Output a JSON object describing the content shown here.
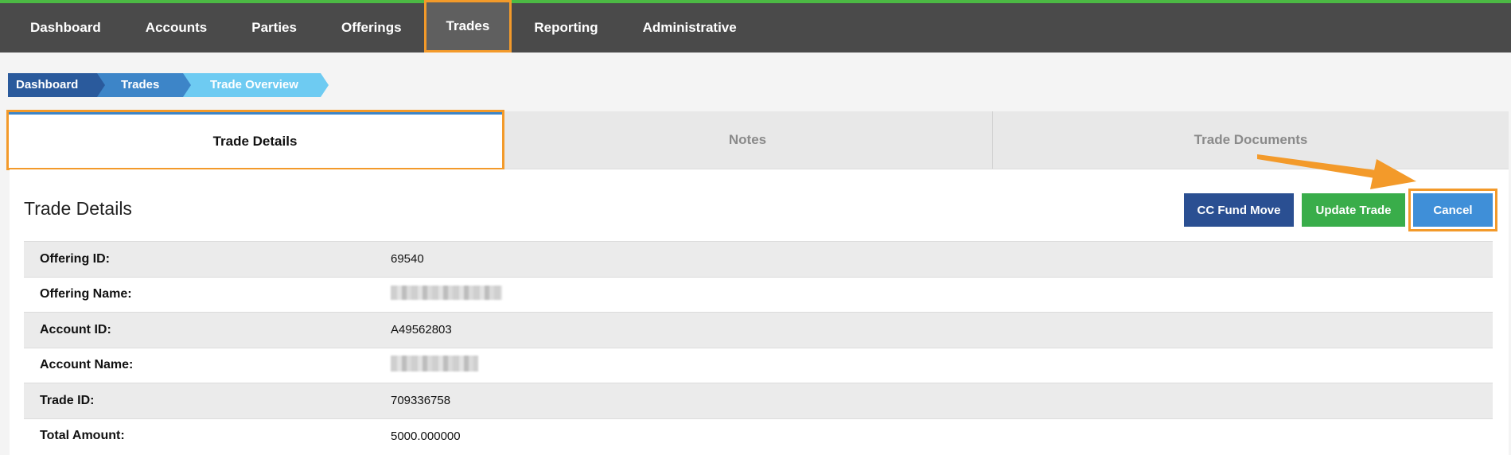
{
  "nav": {
    "items": [
      {
        "label": "Dashboard"
      },
      {
        "label": "Accounts"
      },
      {
        "label": "Parties"
      },
      {
        "label": "Offerings"
      },
      {
        "label": "Trades",
        "active": true
      },
      {
        "label": "Reporting"
      },
      {
        "label": "Administrative"
      }
    ]
  },
  "breadcrumb": [
    "Dashboard",
    "Trades",
    "Trade Overview"
  ],
  "tabs": [
    "Trade Details",
    "Notes",
    "Trade Documents"
  ],
  "panel": {
    "title": "Trade Details",
    "buttons": {
      "cc_fund_move": "CC Fund Move",
      "update_trade": "Update Trade",
      "cancel": "Cancel"
    }
  },
  "details": [
    {
      "label": "Offering ID:",
      "value": "69540"
    },
    {
      "label": "Offering Name:",
      "value": ""
    },
    {
      "label": "Account ID:",
      "value": "A49562803"
    },
    {
      "label": "Account Name:",
      "value": ""
    },
    {
      "label": "Trade ID:",
      "value": "709336758"
    },
    {
      "label": "Total Amount:",
      "value": "5000.000000"
    }
  ],
  "colors": {
    "nav_bg": "#4a4a4a",
    "nav_top_border": "#4cb944",
    "highlight": "#f39a2a",
    "cc_button": "#2a4f92",
    "update_button": "#39ad4a",
    "cancel_button": "#3f8fd8"
  }
}
